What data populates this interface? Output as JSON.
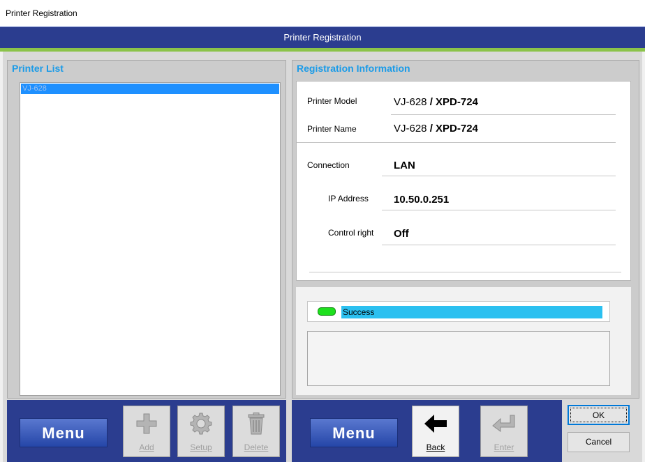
{
  "window": {
    "title": "Printer Registration"
  },
  "header": {
    "title": "Printer Registration"
  },
  "printer_list": {
    "title": "Printer List",
    "items": [
      "VJ-628"
    ]
  },
  "registration": {
    "title": "Registration Information",
    "model_label": "Printer Model",
    "model_value_prefix": "VJ-628",
    "model_value_suffix": " / XPD-724",
    "name_label": "Printer Name",
    "name_value_prefix": "VJ-628",
    "name_value_suffix": " / XPD-724",
    "connection_label": "Connection",
    "connection_value": "LAN",
    "ip_label": "IP Address",
    "ip_value": "10.50.0.251",
    "control_label": "Control right",
    "control_value": "Off"
  },
  "status": {
    "text": "Success",
    "led_color": "#1ee01e"
  },
  "toolbar_left": {
    "menu_label": "Menu",
    "add_label": "Add",
    "setup_label": "Setup",
    "delete_label": "Delete"
  },
  "toolbar_right": {
    "menu_label": "Menu",
    "back_label": "Back",
    "enter_label": "Enter"
  },
  "dialog": {
    "ok_label": "OK",
    "cancel_label": "Cancel"
  },
  "colors": {
    "accent_blue": "#2b3d8f",
    "title_blue": "#1a9be8",
    "green_stripe": "#8bc34a",
    "selection": "#1e90ff"
  }
}
